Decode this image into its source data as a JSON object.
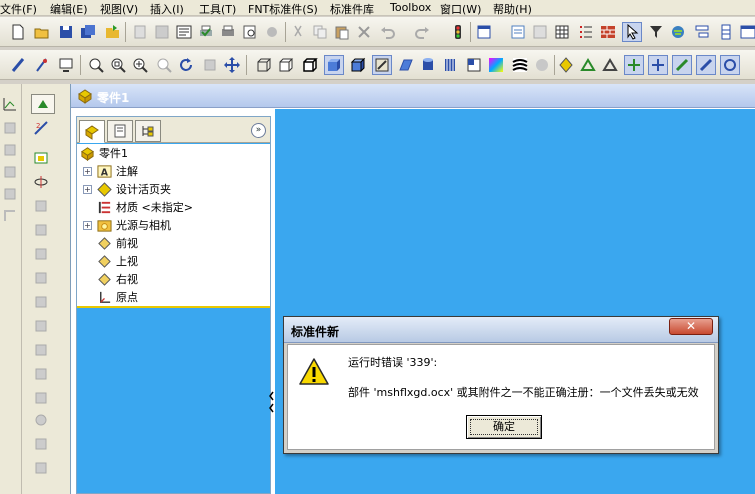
{
  "menubar": {
    "items": [
      "文件(F)",
      "编辑(E)",
      "视图(V)",
      "插入(I)",
      "工具(T)",
      "FNT标准件(S)",
      "标准件库",
      "Toolbox",
      "窗口(W)",
      "帮助(H)"
    ]
  },
  "toolbar": {
    "standard_icons": [
      "new-file-icon",
      "open-folder-icon",
      "save-icon",
      "save-all-icon",
      "open-document-icon",
      "make-drawing-icon",
      "make-assembly-icon",
      "properties-icon",
      "print-icon",
      "print-preview-icon",
      "magnify-icon",
      "cut-icon",
      "copy-icon",
      "paste-icon",
      "delete-icon",
      "undo-icon",
      "redo-icon",
      "traffic-light-icon",
      "options-icon",
      "tools-icon",
      "table-icon",
      "list-icon",
      "brick-icon",
      "select-cursor-icon",
      "select-filter-icon",
      "web-icon",
      "stacked-icon",
      "window-icon"
    ],
    "view_icons": [
      "sketch-pen-icon",
      "smart-dimension-icon",
      "display-icon",
      "zoom-fit-icon",
      "zoom-area-icon",
      "zoom-in-icon",
      "zoom-out-icon",
      "rotate-icon",
      "rotate-alt-icon",
      "pan-icon",
      "cube-wireframe-icon",
      "cube-hidden-icon",
      "cube-silhouette-icon",
      "cube-shaded-icon",
      "cube-shaded-edges-icon",
      "cube-draft-icon",
      "plane-icon",
      "cylinder-icon",
      "striped-icon",
      "color-gradient-icon",
      "zebra-icon",
      "sphere-icon",
      "assembly-a-icon",
      "assembly-b-icon",
      "assembly-c-icon",
      "assembly-d-icon",
      "assembly-e-icon",
      "assembly-f-icon",
      "assembly-g-icon",
      "assembly-h-icon"
    ]
  },
  "document": {
    "title": "零件1"
  },
  "feature_tree": {
    "root": "零件1",
    "items": [
      {
        "label": "注解",
        "icon": "annotation-icon",
        "expandable": true
      },
      {
        "label": "设计活页夹",
        "icon": "design-binder-icon",
        "expandable": true
      },
      {
        "label": "材质 <未指定>",
        "icon": "material-icon",
        "expandable": false
      },
      {
        "label": "光源与相机",
        "icon": "lights-camera-icon",
        "expandable": true
      },
      {
        "label": "前视",
        "icon": "plane-icon",
        "expandable": false
      },
      {
        "label": "上视",
        "icon": "plane-icon",
        "expandable": false
      },
      {
        "label": "右视",
        "icon": "plane-icon",
        "expandable": false
      },
      {
        "label": "原点",
        "icon": "origin-icon",
        "expandable": false
      }
    ],
    "more_glyph": "»"
  },
  "dialog": {
    "title": "标准件新",
    "message_line1": "运行时错误 '339':",
    "message_line2": "部件 'mshflxgd.ocx' 或其附件之一不能正确注册：一个文件丢失或无效",
    "ok_label": "确定",
    "close_glyph": "✕"
  },
  "colors": {
    "viewport_background": "#3aa7ef",
    "window_chrome": "#d4d0c8",
    "selection_accent": "#e8c800"
  }
}
